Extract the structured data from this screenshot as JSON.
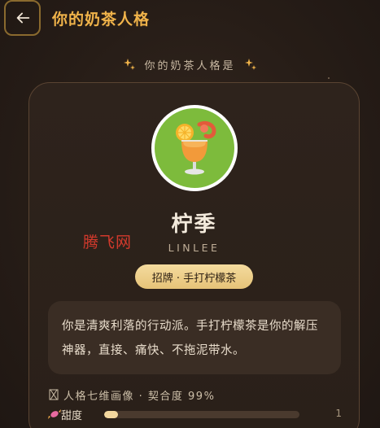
{
  "header": {
    "back_label": "←",
    "title": "你的奶茶人格"
  },
  "subtitle": "你的奶茶人格是",
  "persona": {
    "avatar_icon": "lemon-tea-icon",
    "name": "柠季",
    "english_name": "LINLEE",
    "tag": "招牌 · 手打柠檬茶",
    "description": "你是清爽利落的行动派。手打柠檬茶是你的解压神器，直接、痛快、不拖泥带水。"
  },
  "dimensions": {
    "header": "人格七维画像 · 契合度 99%",
    "items": [
      {
        "label": "甜度",
        "icon": "candy-icon",
        "value_label": "1",
        "level": 0.07
      }
    ]
  },
  "watermark": "腾飞网",
  "colors": {
    "accent": "#f0b34a",
    "avatar_bg": "#7dbb3c",
    "pill": "#f4db9e",
    "background": "#2a1f1a"
  }
}
